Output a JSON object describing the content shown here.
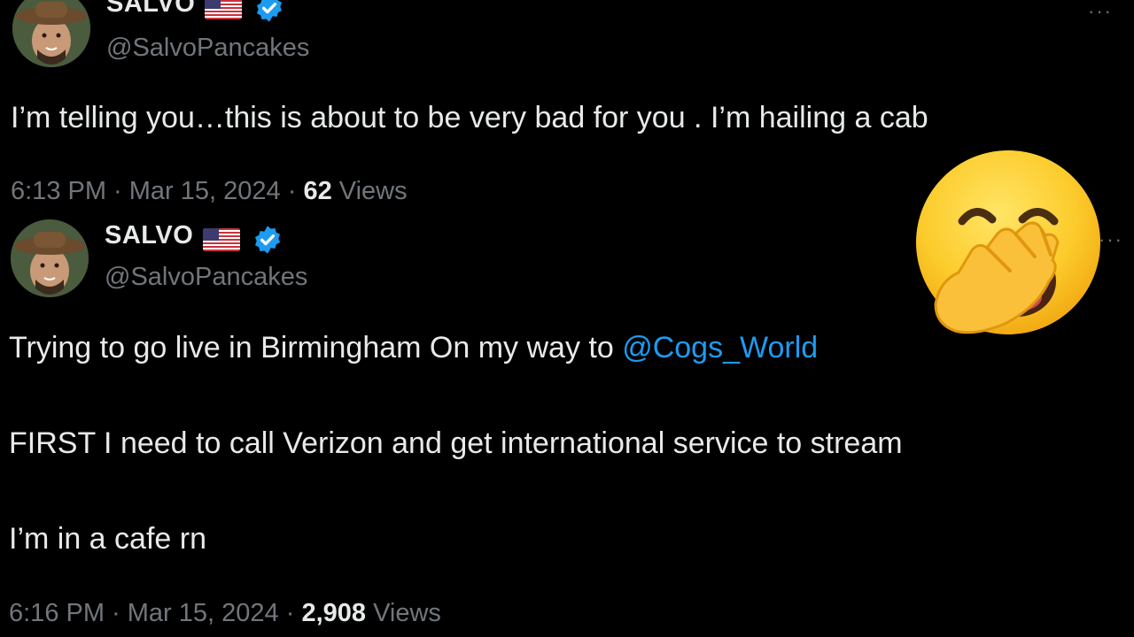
{
  "tweets": [
    {
      "name": "SALVO",
      "handle": "@SalvoPancakes",
      "text": "I’m telling you…this is about to be very bad for you . I’m hailing a cab",
      "time": "6:13 PM · Mar 15, 2024 · ",
      "views_count": "62",
      "views_label": " Views",
      "more": "···"
    },
    {
      "name": "SALVO",
      "handle": "@SalvoPancakes",
      "line1_prefix": "Trying to go live in Birmingham On my way to ",
      "line1_mention": "@Cogs_World",
      "line2": "FIRST I need to call Verizon and get international service to stream",
      "line3": "I’m in a cafe rn",
      "time": "6:16 PM · Mar 15, 2024 · ",
      "views_count": "2,908",
      "views_label": " Views",
      "more": "···"
    }
  ],
  "emoji": "yawning-face-icon",
  "colors": {
    "background": "#000000",
    "text": "#e7e9ea",
    "muted": "#71767b",
    "accent": "#1d9bf0"
  }
}
